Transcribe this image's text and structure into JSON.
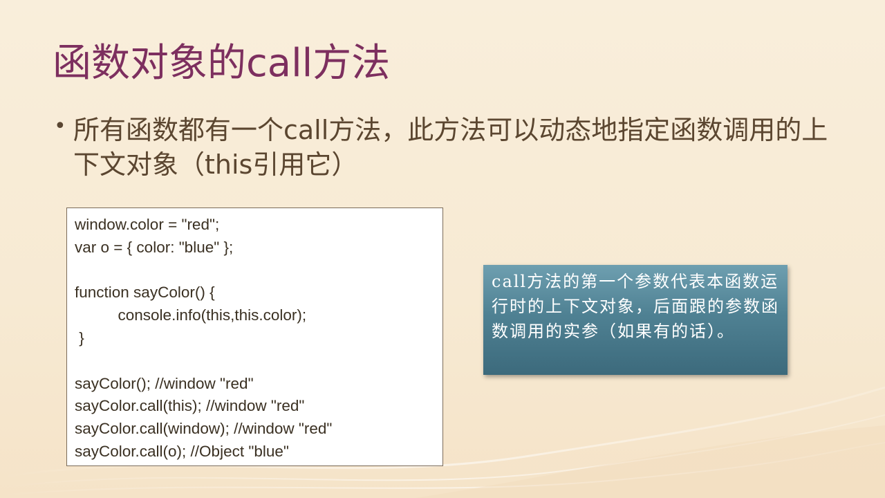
{
  "slide": {
    "title": "函数对象的call方法",
    "bullet_text": "所有函数都有一个call方法，此方法可以动态地指定函数调用的上下文对象（this引用它）",
    "code_lines": [
      "window.color = \"red\";",
      "var o = { color: \"blue\" };",
      "",
      "function sayColor() {",
      "\t\tconsole.info(this,this.color);",
      " }",
      "",
      "sayColor(); //window \"red\"",
      "sayColor.call(this); //window \"red\"",
      "sayColor.call(window); //window \"red\"",
      "sayColor.call(o); //Object \"blue\""
    ],
    "note_text": "call方法的第一个参数代表本函数运行时的上下文对象，后面跟的参数函数调用的实参（如果有的话）。"
  },
  "colors": {
    "background": "#f8ecd6",
    "title": "#7d2f5f",
    "body_text": "#5b4630",
    "note_bg": "#4f8193"
  }
}
